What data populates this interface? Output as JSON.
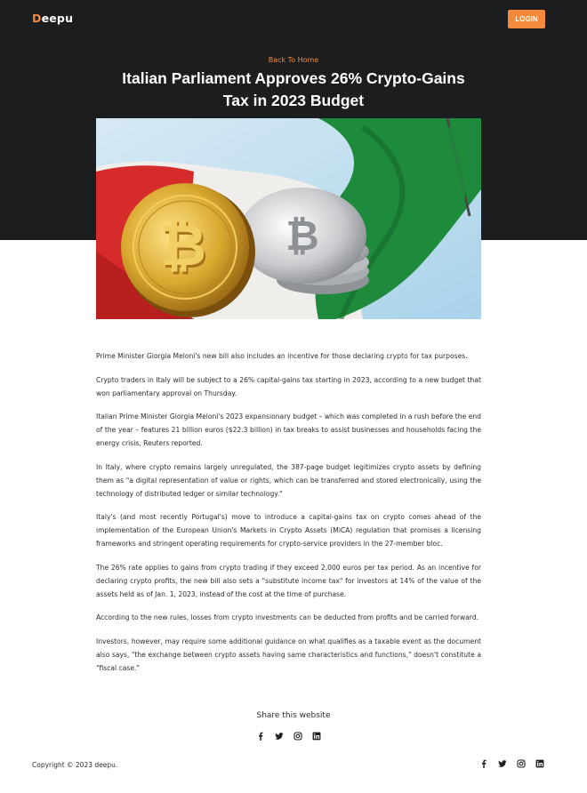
{
  "header": {
    "brand_first": "D",
    "brand_rest": "eepu",
    "login_label": "LOGIN"
  },
  "hero": {
    "back_link": "Back To Home",
    "title": "Italian Parliament Approves 26% Crypto-Gains Tax in 2023 Budget"
  },
  "article": {
    "paragraphs": [
      "Prime Minister Giorgia Meloni's new bill also includes an incentive for those declaring crypto for tax purposes.",
      "Crypto traders in Italy will be subject to a 26% capital-gains tax starting in 2023, according to a new budget that won parliamentary approval on Thursday.",
      "Italian Prime Minister Giorgia Meloni's 2023 expansionary budget – which was completed in a rush before the end of the year – features 21 billion euros ($22.3 billion) in tax breaks to assist businesses and households facing the energy crisis, Reuters reported.",
      "In Italy, where crypto remains largely unregulated, the 387-page budget legitimizes crypto assets by defining them as \"a digital representation of value or rights, which can be transferred and stored electronically, using the technology of distributed ledger or similar technology.\"",
      "Italy's (and most recently Portugal's) move to introduce a capital-gains tax on crypto comes ahead of the implementation of the European Union's Markets in Crypto Assets (MiCA) regulation that promises a licensing frameworks and stringent operating requirements for crypto-service providers in the 27-member bloc.",
      "The 26% rate applies to gains from crypto trading if they exceed 2,000 euros per tax period. As an incentive for declaring crypto profits, the new bill also sets a \"substitute income tax\" for investors at 14% of the value of the assets held as of Jan. 1, 2023, instead of the cost at the time of purchase.",
      "According to the new rules, losses from crypto investments can be deducted from profits and be carried forward.",
      "Investors, however, may require some additional guidance on what qualifies as a taxable event as the document also says, \"the exchange between crypto assets having same characteristics and functions,\" doesn't constitute a \"fiscal case.\""
    ]
  },
  "share": {
    "label": "Share this website",
    "icons": [
      "facebook-icon",
      "twitter-icon",
      "instagram-icon",
      "linkedin-icon"
    ]
  },
  "footer": {
    "copyright": "Copyright © 2023 deepu.",
    "icons": [
      "facebook-icon",
      "twitter-icon",
      "instagram-icon",
      "linkedin-icon"
    ]
  },
  "colors": {
    "accent": "#f58a3c",
    "hero_background": "#1b1d1f",
    "text": "#2d2d2d"
  }
}
